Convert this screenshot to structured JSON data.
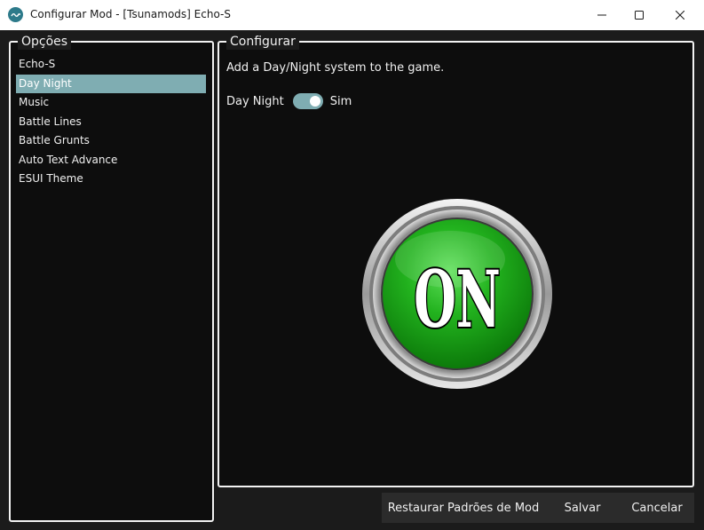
{
  "window": {
    "title": "Configurar Mod - [Tsunamods] Echo-S"
  },
  "options": {
    "legend": "Opções",
    "items": [
      {
        "label": "Echo-S",
        "selected": false
      },
      {
        "label": "Day Night",
        "selected": true
      },
      {
        "label": "Music",
        "selected": false
      },
      {
        "label": "Battle Lines",
        "selected": false
      },
      {
        "label": "Battle Grunts",
        "selected": false
      },
      {
        "label": "Auto Text Advance",
        "selected": false
      },
      {
        "label": "ESUI Theme",
        "selected": false
      }
    ]
  },
  "config": {
    "legend": "Configurar",
    "description": "Add a Day/Night system to the game.",
    "toggle_label": "Day Night",
    "toggle_value": "Sim",
    "toggle_on": true,
    "preview_text": "ON"
  },
  "buttons": {
    "restore": "Restaurar Padrões de Mod",
    "save": "Salvar",
    "cancel": "Cancelar"
  },
  "colors": {
    "accent": "#7fadb2",
    "panel_bg": "#0d0d0d",
    "border": "#f2f2f2",
    "button_green": "#22b21e"
  },
  "icons": {
    "app": "tsunamods-icon",
    "minimize": "minimize-icon",
    "maximize": "maximize-icon",
    "close": "close-icon"
  }
}
